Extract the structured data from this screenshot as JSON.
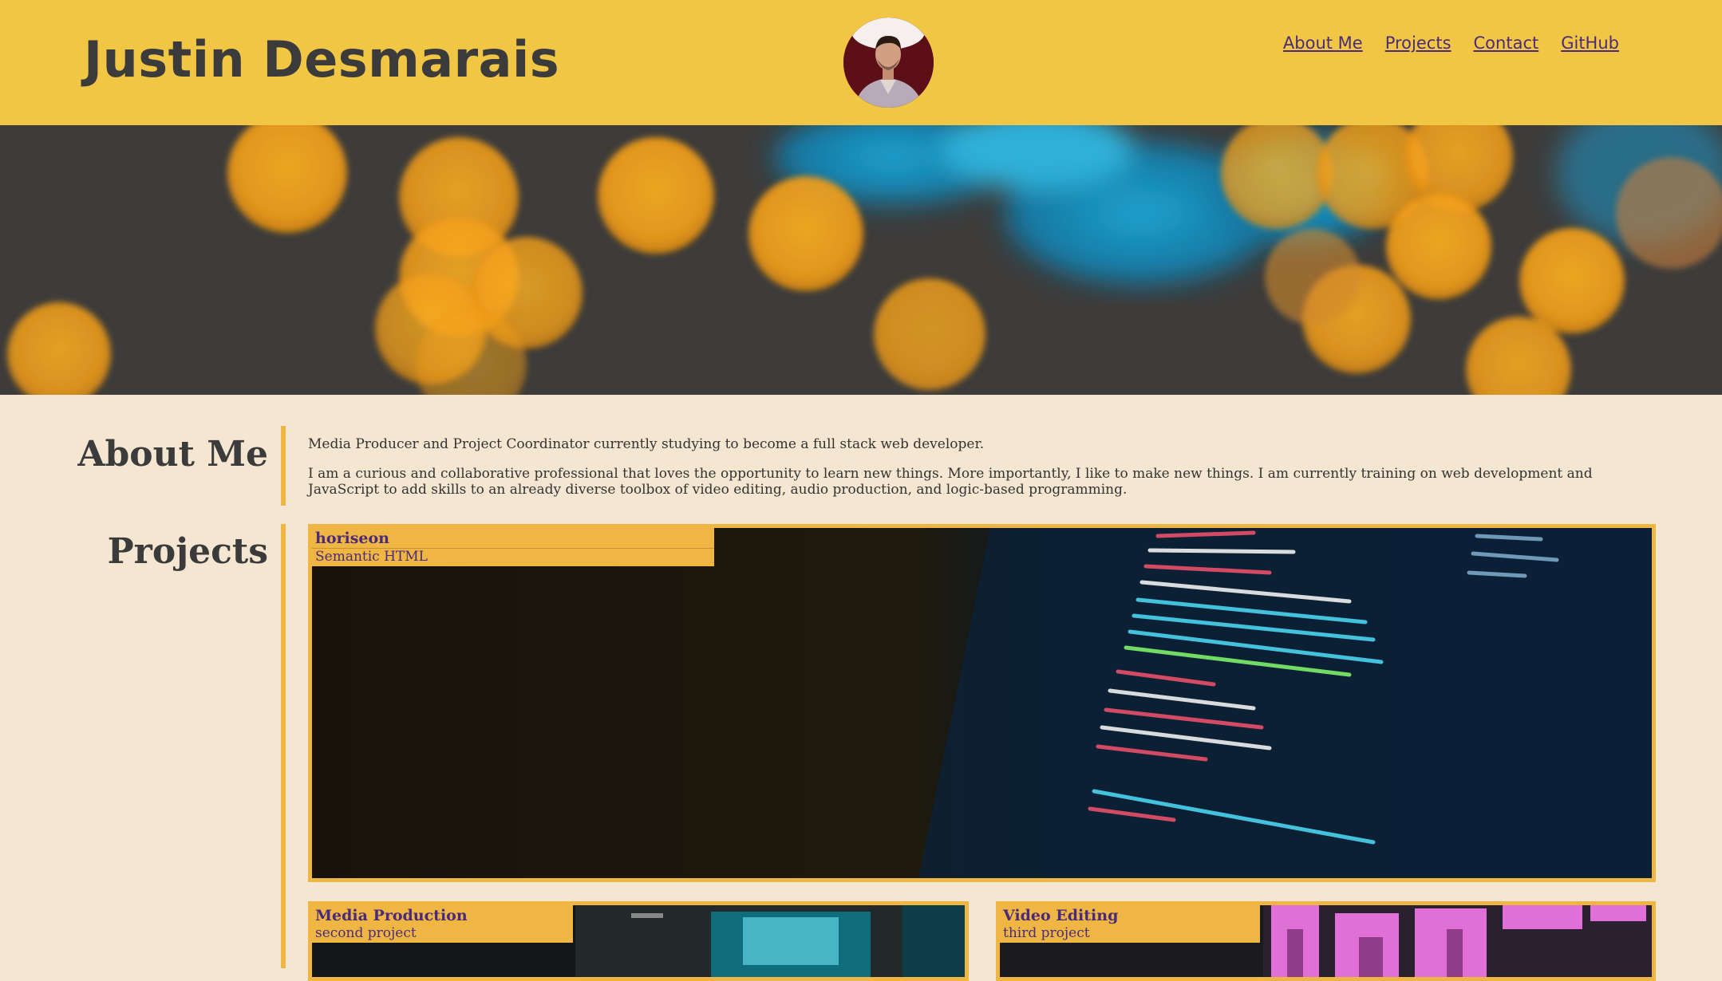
{
  "header": {
    "title": "Justin Desmarais",
    "nav": [
      "About Me",
      "Projects",
      "Contact",
      "GitHub"
    ]
  },
  "about": {
    "heading": "About Me",
    "paragraphs": [
      "Media Producer and Project Coordinator currently studying to become a full stack web developer.",
      "I am a curious and collaborative professional that loves the opportunity to learn new things. More importantly, I like to make new things. I am currently training on web development and JavaScript to add skills to an already diverse toolbox of video editing, audio production, and logic-based programming."
    ]
  },
  "projects": {
    "heading": "Projects",
    "items": [
      {
        "title": "horiseon",
        "subtitle": "Semantic HTML"
      },
      {
        "title": "Media Production",
        "subtitle": "second project"
      },
      {
        "title": "Video Editing",
        "subtitle": "third project"
      }
    ]
  },
  "colors": {
    "header_bg": "#f2c645",
    "page_bg": "#f4e6d1",
    "accent": "#f0b644",
    "link": "#4a2b7a"
  }
}
